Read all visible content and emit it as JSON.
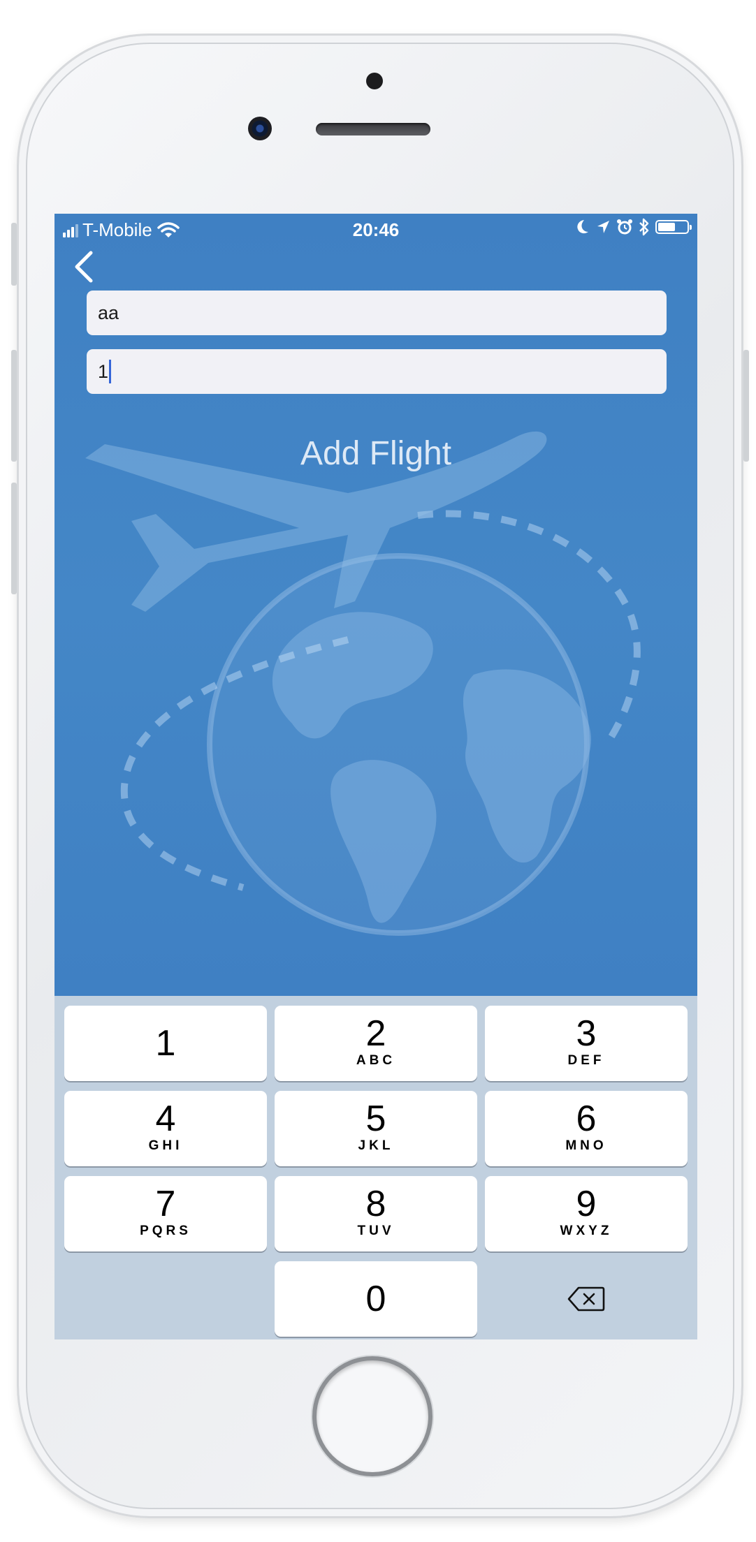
{
  "status_bar": {
    "carrier": "T-Mobile",
    "time": "20:46"
  },
  "form": {
    "field_1_value": "aa",
    "field_2_value": "1",
    "submit_label": "Add Flight"
  },
  "keypad": {
    "keys": [
      {
        "num": "1",
        "letters": ""
      },
      {
        "num": "2",
        "letters": "ABC"
      },
      {
        "num": "3",
        "letters": "DEF"
      },
      {
        "num": "4",
        "letters": "GHI"
      },
      {
        "num": "5",
        "letters": "JKL"
      },
      {
        "num": "6",
        "letters": "MNO"
      },
      {
        "num": "7",
        "letters": "PQRS"
      },
      {
        "num": "8",
        "letters": "TUV"
      },
      {
        "num": "9",
        "letters": "WXYZ"
      },
      {
        "num": "0",
        "letters": ""
      }
    ],
    "delete_icon": "backspace-icon"
  },
  "colors": {
    "background_blue": "#3f81c4",
    "keypad_bg": "#c1d0df",
    "caret": "#3566d8"
  }
}
